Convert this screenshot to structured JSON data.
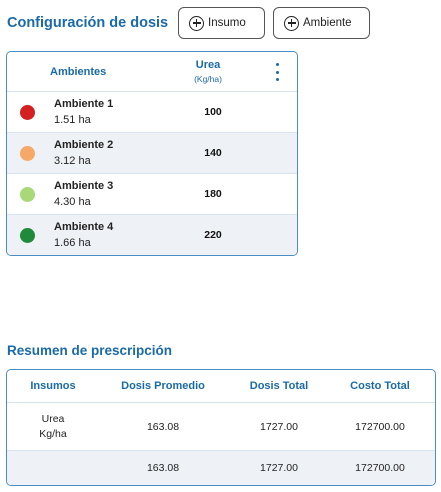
{
  "config": {
    "title": "Configuración de dosis",
    "add_insumo_label": "Insumo",
    "add_ambiente_label": "Ambiente"
  },
  "dose_table": {
    "col_ambientes": "Ambientes",
    "col_urea": "Urea",
    "col_urea_unit": "(Kg/ha)",
    "rows": [
      {
        "name": "Ambiente 1",
        "area": "1.51 ha",
        "dose": "100",
        "color": "#d42020"
      },
      {
        "name": "Ambiente 2",
        "area": "3.12 ha",
        "dose": "140",
        "color": "#f6a868"
      },
      {
        "name": "Ambiente 3",
        "area": "4.30 ha",
        "dose": "180",
        "color": "#a8d878"
      },
      {
        "name": "Ambiente 4",
        "area": "1.66 ha",
        "dose": "220",
        "color": "#1e8a3a"
      }
    ]
  },
  "summary": {
    "title": "Resumen de prescripción",
    "headers": [
      "Insumos",
      "Dosis Promedio",
      "Dosis Total",
      "Costo Total"
    ],
    "row": {
      "insumo_name": "Urea",
      "insumo_unit": "Kg/ha",
      "dosis_promedio": "163.08",
      "dosis_total": "1727.00",
      "costo_total": "172700.00"
    },
    "total_row": {
      "dosis_promedio": "163.08",
      "dosis_total": "1727.00",
      "costo_total": "172700.00"
    }
  },
  "colors": {
    "accent": "#1a6aa8",
    "border": "#4a8cc4",
    "row_alt": "#eef2f6"
  }
}
